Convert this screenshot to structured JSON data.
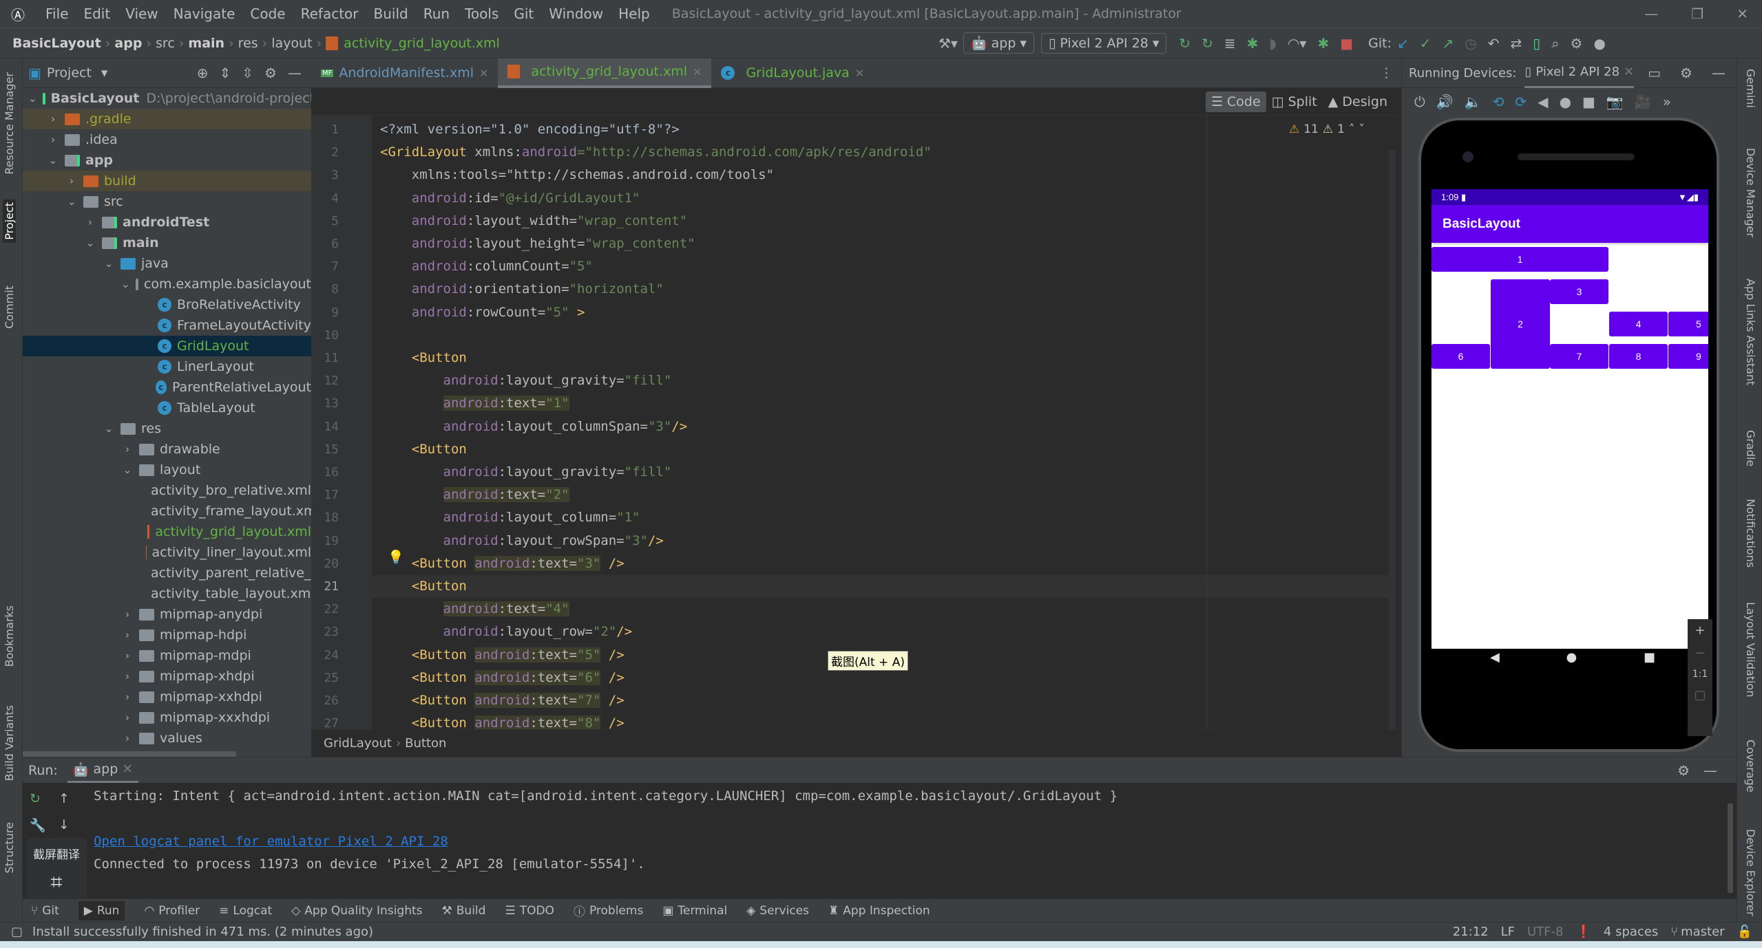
{
  "titlebar": {
    "menu": [
      "File",
      "Edit",
      "View",
      "Navigate",
      "Code",
      "Refactor",
      "Build",
      "Run",
      "Tools",
      "Git",
      "Window",
      "Help"
    ],
    "title": "BasicLayout - activity_grid_layout.xml [BasicLayout.app.main] - Administrator"
  },
  "navbar": {
    "breadcrumb": [
      "BasicLayout",
      "app",
      "src",
      "main",
      "res",
      "layout",
      "activity_grid_layout.xml"
    ],
    "run_config": "app",
    "device": "Pixel 2 API 28",
    "git_label": "Git:"
  },
  "project_panel": {
    "title": "Project",
    "tree": [
      {
        "label": "BasicLayout",
        "extra": "D:\\project\\android-project\\",
        "depth": 0,
        "open": true,
        "bold": true,
        "icon": "module"
      },
      {
        "label": ".gradle",
        "depth": 1,
        "open": false,
        "icon": "folder-orange",
        "color": "#a5a534",
        "excluded": true
      },
      {
        "label": ".idea",
        "depth": 1,
        "open": false,
        "icon": "folder"
      },
      {
        "label": "app",
        "depth": 1,
        "open": true,
        "bold": true,
        "icon": "module"
      },
      {
        "label": "build",
        "depth": 2,
        "open": false,
        "icon": "folder-orange",
        "color": "#a5a534",
        "excluded": true
      },
      {
        "label": "src",
        "depth": 2,
        "open": true,
        "icon": "folder"
      },
      {
        "label": "androidTest",
        "depth": 3,
        "open": false,
        "bold": true,
        "icon": "module"
      },
      {
        "label": "main",
        "depth": 3,
        "open": true,
        "bold": true,
        "icon": "module"
      },
      {
        "label": "java",
        "depth": 4,
        "open": true,
        "icon": "folder-blue"
      },
      {
        "label": "com.example.basiclayout",
        "depth": 5,
        "open": true,
        "icon": "package"
      },
      {
        "label": "BroRelativeActivity",
        "depth": 6,
        "icon": "class"
      },
      {
        "label": "FrameLayoutActivity",
        "depth": 6,
        "icon": "class"
      },
      {
        "label": "GridLayout",
        "depth": 6,
        "icon": "class",
        "selected": true,
        "color": "#62b543"
      },
      {
        "label": "LinerLayout",
        "depth": 6,
        "icon": "class"
      },
      {
        "label": "ParentRelativeLayout",
        "depth": 6,
        "icon": "class"
      },
      {
        "label": "TableLayout",
        "depth": 6,
        "icon": "class"
      },
      {
        "label": "res",
        "depth": 4,
        "open": true,
        "icon": "folder-res"
      },
      {
        "label": "drawable",
        "depth": 5,
        "open": false,
        "icon": "folder"
      },
      {
        "label": "layout",
        "depth": 5,
        "open": true,
        "icon": "folder"
      },
      {
        "label": "activity_bro_relative.xml",
        "depth": 6,
        "icon": "xml"
      },
      {
        "label": "activity_frame_layout.xml",
        "depth": 6,
        "icon": "xml"
      },
      {
        "label": "activity_grid_layout.xml",
        "depth": 6,
        "icon": "xml",
        "color": "#62b543"
      },
      {
        "label": "activity_liner_layout.xml",
        "depth": 6,
        "icon": "xml"
      },
      {
        "label": "activity_parent_relative_layout.xml",
        "depth": 6,
        "icon": "xml"
      },
      {
        "label": "activity_table_layout.xml",
        "depth": 6,
        "icon": "xml"
      },
      {
        "label": "mipmap-anydpi",
        "depth": 5,
        "open": false,
        "icon": "folder"
      },
      {
        "label": "mipmap-hdpi",
        "depth": 5,
        "open": false,
        "icon": "folder"
      },
      {
        "label": "mipmap-mdpi",
        "depth": 5,
        "open": false,
        "icon": "folder"
      },
      {
        "label": "mipmap-xhdpi",
        "depth": 5,
        "open": false,
        "icon": "folder"
      },
      {
        "label": "mipmap-xxhdpi",
        "depth": 5,
        "open": false,
        "icon": "folder"
      },
      {
        "label": "mipmap-xxxhdpi",
        "depth": 5,
        "open": false,
        "icon": "folder"
      },
      {
        "label": "values",
        "depth": 5,
        "open": false,
        "icon": "folder"
      }
    ]
  },
  "left_stripe": [
    "Resource Manager",
    "Project",
    "Commit",
    "Bookmarks",
    "Build Variants",
    "Structure"
  ],
  "right_stripe": [
    "Gemini",
    "Device Manager",
    "App Links Assistant",
    "Gradle",
    "Notifications",
    "Layout Validation",
    "Coverage",
    "Device Explorer"
  ],
  "editor": {
    "tabs": [
      {
        "label": "AndroidManifest.xml",
        "color": "#6897bb"
      },
      {
        "label": "activity_grid_layout.xml",
        "color": "#62b543",
        "active": true
      },
      {
        "label": "GridLayout.java",
        "color": "#62b543"
      }
    ],
    "modes": [
      "Code",
      "Split",
      "Design"
    ],
    "inspections": {
      "warnings": "11",
      "weak_warnings": "1"
    },
    "current_line": 21,
    "lines": [
      [
        [
          "pl",
          "<?xml version=\"1.0\" encoding=\"utf-8\"?>"
        ]
      ],
      [
        [
          "tag",
          "<GridLayout "
        ],
        [
          "attr",
          "xmlns:"
        ],
        [
          "ns",
          "android"
        ],
        [
          "str",
          "=\"http://schemas.android.com/apk/res/android\""
        ]
      ],
      [
        [
          "attr",
          "    xmlns:tools=\"http://schemas.android.com/tools\""
        ]
      ],
      [
        [
          "ns",
          "    android"
        ],
        [
          "attr",
          ":id="
        ],
        [
          "str",
          "\"@+id/GridLayout1\""
        ]
      ],
      [
        [
          "ns",
          "    android"
        ],
        [
          "attr",
          ":layout_width="
        ],
        [
          "str",
          "\"wrap_content\""
        ]
      ],
      [
        [
          "ns",
          "    android"
        ],
        [
          "attr",
          ":layout_height="
        ],
        [
          "str",
          "\"wrap_content\""
        ]
      ],
      [
        [
          "ns",
          "    android"
        ],
        [
          "attr",
          ":columnCount="
        ],
        [
          "str",
          "\"5\""
        ]
      ],
      [
        [
          "ns",
          "    android"
        ],
        [
          "attr",
          ":orientation="
        ],
        [
          "str",
          "\"horizontal\""
        ]
      ],
      [
        [
          "ns",
          "    android"
        ],
        [
          "attr",
          ":rowCount="
        ],
        [
          "str",
          "\"5\""
        ],
        [
          "tag",
          " >"
        ]
      ],
      [
        [
          "pl",
          ""
        ]
      ],
      [
        [
          "pl",
          "    "
        ],
        [
          "tag",
          "<Button"
        ]
      ],
      [
        [
          "ns",
          "        android"
        ],
        [
          "attr",
          ":layout_gravity="
        ],
        [
          "str",
          "\"fill\""
        ]
      ],
      [
        [
          "pl",
          "        "
        ],
        [
          "hns",
          "android"
        ],
        [
          "hattr",
          ":text="
        ],
        [
          "hstr",
          "\"1\""
        ]
      ],
      [
        [
          "ns",
          "        android"
        ],
        [
          "attr",
          ":layout_columnSpan="
        ],
        [
          "str",
          "\"3\""
        ],
        [
          "tag",
          "/>"
        ]
      ],
      [
        [
          "pl",
          "    "
        ],
        [
          "tag",
          "<Button"
        ]
      ],
      [
        [
          "ns",
          "        android"
        ],
        [
          "attr",
          ":layout_gravity="
        ],
        [
          "str",
          "\"fill\""
        ]
      ],
      [
        [
          "pl",
          "        "
        ],
        [
          "hns",
          "android"
        ],
        [
          "hattr",
          ":text="
        ],
        [
          "hstr",
          "\"2\""
        ]
      ],
      [
        [
          "ns",
          "        android"
        ],
        [
          "attr",
          ":layout_column="
        ],
        [
          "str",
          "\"1\""
        ]
      ],
      [
        [
          "ns",
          "        android"
        ],
        [
          "attr",
          ":layout_rowSpan="
        ],
        [
          "str",
          "\"3\""
        ],
        [
          "tag",
          "/>"
        ]
      ],
      [
        [
          "pl",
          "    "
        ],
        [
          "tag",
          "<Button "
        ],
        [
          "hns",
          "android"
        ],
        [
          "hattr",
          ":text="
        ],
        [
          "hstr",
          "\"3\""
        ],
        [
          "tag",
          " />"
        ]
      ],
      [
        [
          "pl",
          "    "
        ],
        [
          "tag",
          "<Button"
        ]
      ],
      [
        [
          "pl",
          "        "
        ],
        [
          "hns",
          "android"
        ],
        [
          "hattr",
          ":text="
        ],
        [
          "hstr",
          "\"4\""
        ]
      ],
      [
        [
          "ns",
          "        android"
        ],
        [
          "attr",
          ":layout_row="
        ],
        [
          "str",
          "\"2\""
        ],
        [
          "tag",
          "/>"
        ]
      ],
      [
        [
          "pl",
          "    "
        ],
        [
          "tag",
          "<Button "
        ],
        [
          "hns",
          "android"
        ],
        [
          "hattr",
          ":text="
        ],
        [
          "hstr",
          "\"5\""
        ],
        [
          "tag",
          " />"
        ]
      ],
      [
        [
          "pl",
          "    "
        ],
        [
          "tag",
          "<Button "
        ],
        [
          "hns",
          "android"
        ],
        [
          "hattr",
          ":text="
        ],
        [
          "hstr",
          "\"6\""
        ],
        [
          "tag",
          " />"
        ]
      ],
      [
        [
          "pl",
          "    "
        ],
        [
          "tag",
          "<Button "
        ],
        [
          "hns",
          "android"
        ],
        [
          "hattr",
          ":text="
        ],
        [
          "hstr",
          "\"7\""
        ],
        [
          "tag",
          " />"
        ]
      ],
      [
        [
          "pl",
          "    "
        ],
        [
          "tag",
          "<Button "
        ],
        [
          "hns",
          "android"
        ],
        [
          "hattr",
          ":text="
        ],
        [
          "hstr",
          "\"8\""
        ],
        [
          "tag",
          " />"
        ]
      ]
    ],
    "breadcrumb": [
      "GridLayout",
      "Button"
    ],
    "tooltip": "截图(Alt + A)"
  },
  "running_devices": {
    "label": "Running Devices:",
    "device_tab": "Pixel 2 API 28",
    "zoom_label": "1:1",
    "phone": {
      "time": "1:09",
      "app_title": "BasicLayout",
      "accent": "#6200ee",
      "status_bar": "#3700b3",
      "buttons": [
        "1",
        "2",
        "3",
        "4",
        "5",
        "6",
        "7",
        "8",
        "9"
      ]
    }
  },
  "run_panel": {
    "label": "Run:",
    "tab": "app",
    "output": [
      "Starting: Intent { act=android.intent.action.MAIN cat=[android.intent.category.LAUNCHER] cmp=com.example.basiclayout/.GridLayout }",
      "Open logcat panel for emulator Pixel 2 API 28",
      "Connected to process 11973 on device 'Pixel_2_API_28 [emulator-5554]'."
    ],
    "overlay_label": "截屏翻译"
  },
  "bottom_tabs": [
    "Git",
    "Run",
    "Profiler",
    "Logcat",
    "App Quality Insights",
    "Build",
    "TODO",
    "Problems",
    "Terminal",
    "Services",
    "App Inspection"
  ],
  "status": {
    "message": "Install successfully finished in 471 ms. (2 minutes ago)",
    "position": "21:12",
    "line_sep": "LF",
    "encoding": "UTF-8",
    "indent": "4 spaces",
    "branch": "master"
  }
}
